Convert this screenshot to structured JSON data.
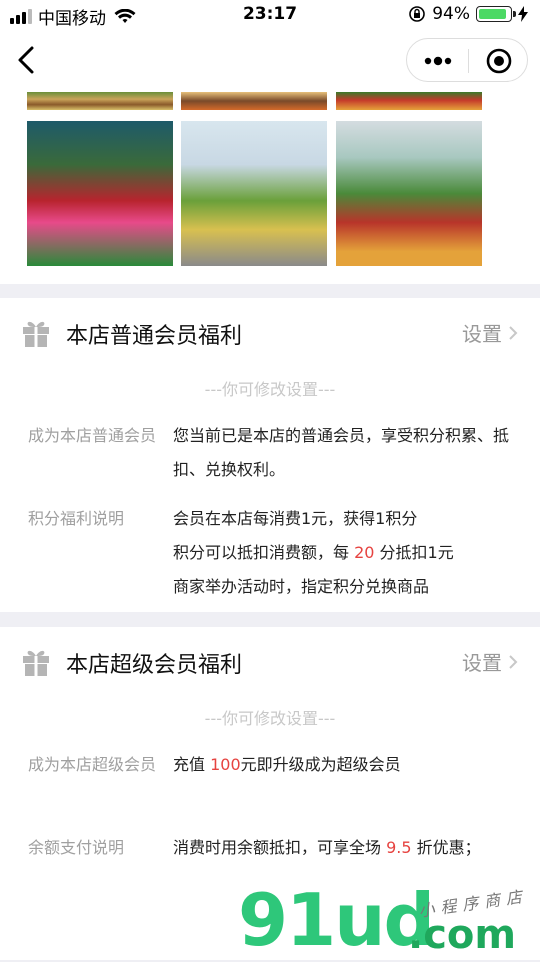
{
  "status_bar": {
    "carrier": "中国移动",
    "time": "23:17",
    "battery_pct": "94%",
    "battery_level": 0.94
  },
  "nav": {
    "back_icon": "chevron-left-icon",
    "more_icon": "more-dots-icon",
    "close_icon": "target-circle-icon"
  },
  "regular": {
    "title": "本店普通会员福利",
    "settings": "设置",
    "hint": "---你可修改设置---",
    "rows": [
      {
        "label": "成为本店普通会员",
        "lines": [
          "您当前已是本店的普通会员，享受积分积累、抵扣、兑换权利。"
        ]
      },
      {
        "label": "积分福利说明",
        "lines": [
          "会员在本店每消费1元，获得1积分"
        ],
        "line2_pre": "积分可以抵扣消费额，每 ",
        "line2_num": "20",
        "line2_post": " 分抵扣1元",
        "line3": "商家举办活动时，指定积分兑换商品"
      }
    ]
  },
  "super": {
    "title": "本店超级会员福利",
    "settings": "设置",
    "hint": "---你可修改设置---",
    "row1_label": "成为本店超级会员",
    "row1_pre": "充值 ",
    "row1_num": "100",
    "row1_post": "元即升级成为超级会员",
    "row2_label": "余额支付说明",
    "row2_pre": "消费时用余额抵扣，可享全场 ",
    "row2_num": "9.5",
    "row2_post": " 折优惠；"
  },
  "watermark": {
    "main": "91ud",
    "com": ".com",
    "sub": "小程序商店"
  },
  "colors": {
    "accent_red": "#e64340",
    "label_gray": "#a0a0a0",
    "hint_gray": "#c8c8c8",
    "battery_green": "#4cd964",
    "watermark_green": "#2ec77a"
  }
}
